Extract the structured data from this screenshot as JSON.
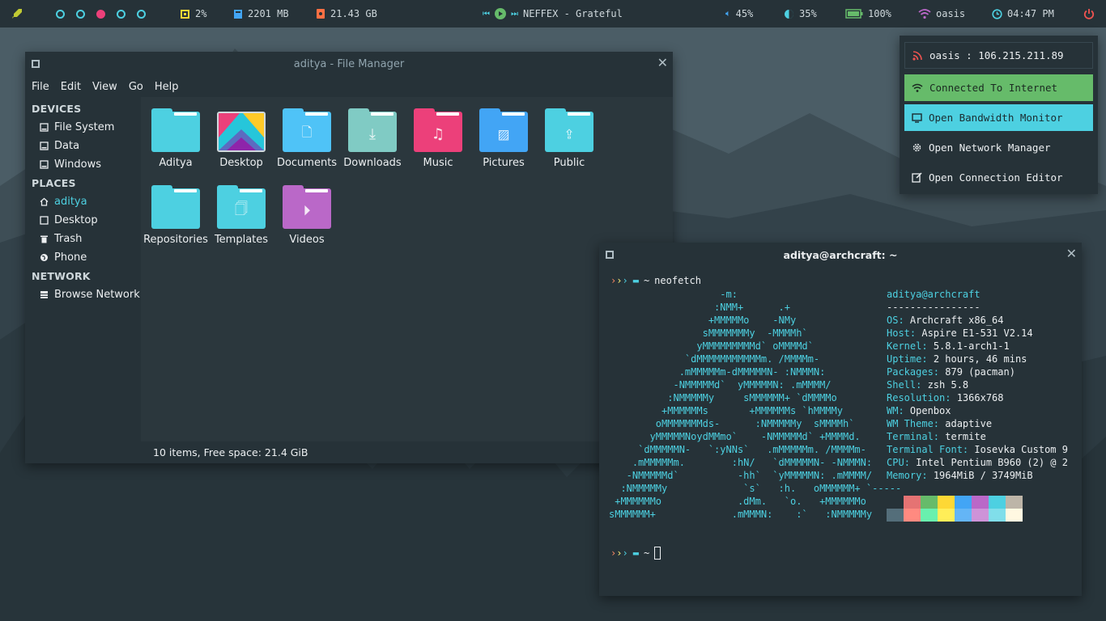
{
  "topbar": {
    "cpu": "2%",
    "memory": "2201 MB",
    "disk": "21.43 GB",
    "music": "NEFFEX - Grateful",
    "volume": "45%",
    "brightness": "35%",
    "battery": "100%",
    "wifi": "oasis",
    "clock": "04:47 PM"
  },
  "network_popup": {
    "header": "oasis : 106.215.211.89",
    "connected": "Connected To Internet",
    "bandwidth": "Open Bandwidth Monitor",
    "manager": "Open Network Manager",
    "editor": "Open Connection Editor"
  },
  "file_manager": {
    "title": "aditya - File Manager",
    "menu": [
      "File",
      "Edit",
      "View",
      "Go",
      "Help"
    ],
    "sidebar": {
      "devices_header": "DEVICES",
      "devices": [
        "File System",
        "Data",
        "Windows"
      ],
      "places_header": "PLACES",
      "places": [
        "aditya",
        "Desktop",
        "Trash",
        "Phone"
      ],
      "network_header": "NETWORK",
      "network": [
        "Browse Network"
      ]
    },
    "folders": [
      "Aditya",
      "Desktop",
      "Documents",
      "Downloads",
      "Music",
      "Pictures",
      "Public",
      "Repositories",
      "Templates",
      "Videos"
    ],
    "status": "10 items, Free space: 21.4 GiB"
  },
  "terminal": {
    "title": "aditya@archcraft: ~",
    "prompt_dir": "~",
    "command": "neofetch",
    "user_host": "aditya@archcraft",
    "separator": "----------------",
    "info": [
      {
        "key": "OS",
        "value": "Archcraft x86_64"
      },
      {
        "key": "Host",
        "value": "Aspire E1-531 V2.14"
      },
      {
        "key": "Kernel",
        "value": "5.8.1-arch1-1"
      },
      {
        "key": "Uptime",
        "value": "2 hours, 46 mins"
      },
      {
        "key": "Packages",
        "value": "879 (pacman)"
      },
      {
        "key": "Shell",
        "value": "zsh 5.8"
      },
      {
        "key": "Resolution",
        "value": "1366x768"
      },
      {
        "key": "WM",
        "value": "Openbox"
      },
      {
        "key": "WM Theme",
        "value": "adaptive"
      },
      {
        "key": "Terminal",
        "value": "termite"
      },
      {
        "key": "Terminal Font",
        "value": "Iosevka Custom 9"
      },
      {
        "key": "CPU",
        "value": "Intel Pentium B960 (2) @ 2"
      },
      {
        "key": "Memory",
        "value": "1964MiB / 3749MiB"
      }
    ],
    "ascii_art": "                   -m:\n                  :NMM+      .+\n                 +MMMMMo    -NMy\n                sMMMMMMMy  -MMMMh`\n               yMMMMMMMMMd` oMMMMd`\n             `dMMMMMMMMMMMm. /MMMMm-\n            .mMMMMMm-dMMMMMN- :NMMMN:\n           -NMMMMMd`  yMMMMMN: .mMMMM/\n          :NMMMMMy     sMMMMMM+ `dMMMMo\n         +MMMMMMs       +MMMMMMs `hMMMMy\n        oMMMMMMMds-      :NMMMMMy  sMMMMh`\n       yMMMMMNoydMMmo`    -NMMMMMd` +MMMMd.\n     `dMMMMMN-   `:yNNs`   .mMMMMMm. /MMMMm-\n    .mMMMMMm.        :hN/   `dMMMMMN- -NMMMN:\n   -NMMMMMd`          -hh`  `yMMMMMN: .mMMMM/\n  :NMMMMMy             `s`   :h.   oMMMMMM+ `-----\n +MMMMMMo             .dMm.   `o.   +MMMMMMo\nsMMMMMM+             .mMMMN:    :`   :NMMMMMy",
    "palette_top": [
      "#263238",
      "#e57373",
      "#66bb6a",
      "#fdd835",
      "#42a5f5",
      "#ba68c8",
      "#4dd0e1",
      "#bdb5a8"
    ],
    "palette_bottom": [
      "#546e7a",
      "#ff8a80",
      "#69f0ae",
      "#ffee58",
      "#64b5f6",
      "#ce93d8",
      "#80deea",
      "#fff8e1"
    ]
  },
  "colors": {
    "accent": "#4dd0e1",
    "active_workspace": "#ec407a",
    "connected": "#66bb6a"
  }
}
